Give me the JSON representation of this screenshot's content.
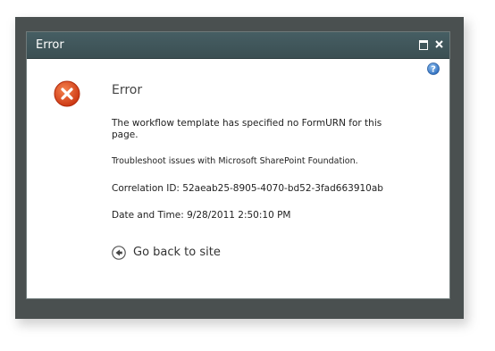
{
  "dialog": {
    "title": "Error",
    "maximize_icon": "maximize-icon",
    "close_icon": "close-icon",
    "help_icon": "help-icon"
  },
  "error": {
    "icon": "error-x-icon",
    "heading": "Error",
    "message": "The workflow template has specified no FormURN for this page.",
    "troubleshoot_link": "Troubleshoot issues with Microsoft SharePoint Foundation.",
    "correlation": "Correlation ID: 52aeab25-8905-4070-bd52-3fad663910ab",
    "datetime": "Date and Time: 9/28/2011 2:50:10 PM"
  },
  "navigation": {
    "go_back_label": "Go back to site",
    "go_back_icon": "back-arrow-icon"
  },
  "colors": {
    "titlebar": "#465e63",
    "frame": "#4a5050",
    "error_red": "#d9441c",
    "help_blue": "#3d7fc9"
  }
}
